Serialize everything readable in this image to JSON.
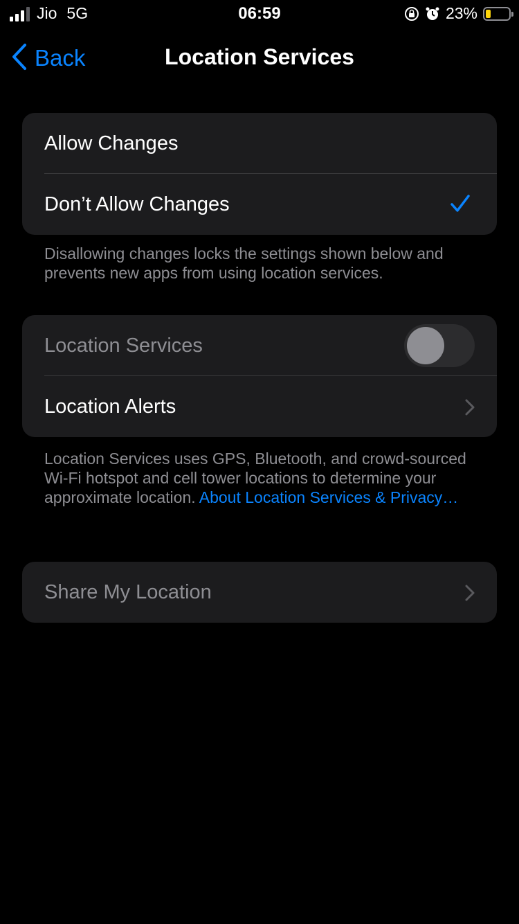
{
  "status_bar": {
    "carrier": "Jio",
    "network": "5G",
    "time": "06:59",
    "battery_percent": "23%",
    "battery_level": 0.23,
    "icons": [
      "signal-icon",
      "orientation-lock-icon",
      "alarm-icon",
      "battery-icon"
    ]
  },
  "nav": {
    "back_label": "Back",
    "title": "Location Services"
  },
  "changes_group": {
    "items": [
      {
        "label": "Allow Changes",
        "checked": false
      },
      {
        "label": "Don’t Allow Changes",
        "checked": true
      }
    ],
    "footer": "Disallowing changes locks the settings shown below and prevents new apps from using location services."
  },
  "location_group": {
    "location_services_label": "Location Services",
    "location_services_on": false,
    "location_alerts_label": "Location Alerts",
    "footer_text": "Location Services uses GPS, Bluetooth, and crowd-sourced Wi-Fi hotspot and cell tower locations to determine your approximate location.",
    "footer_link": "About Location Services & Privacy…"
  },
  "share_group": {
    "share_label": "Share My Location"
  },
  "colors": {
    "background": "#000000",
    "cell": "#1c1c1e",
    "accent": "#0a84ff",
    "secondary_text": "#8e8e93",
    "battery_low": "#ffd60a"
  }
}
